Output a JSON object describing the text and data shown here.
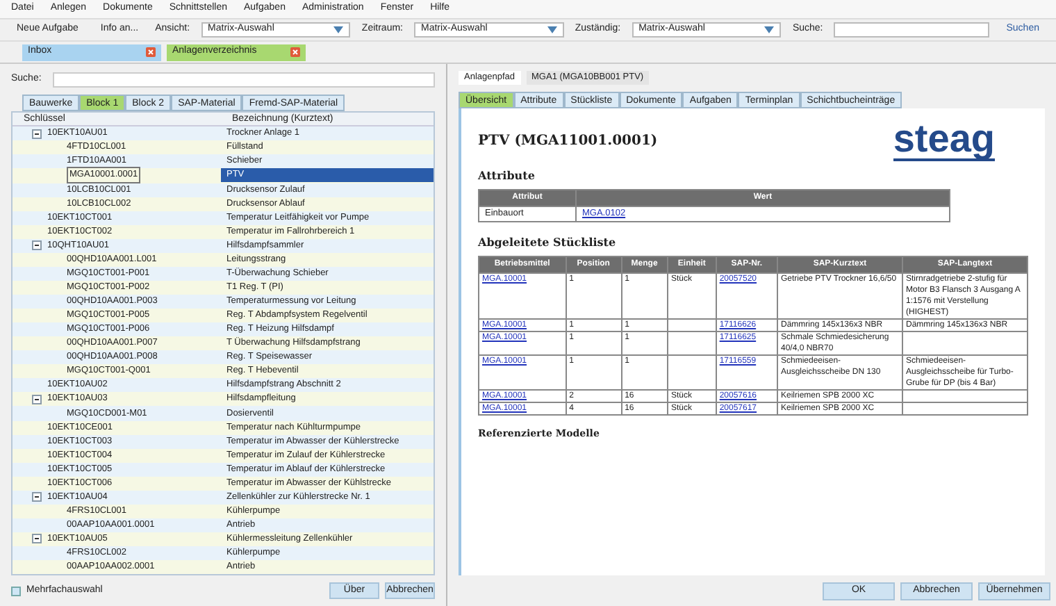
{
  "menu": [
    "Datei",
    "Anlegen",
    "Dokumente",
    "Schnittstellen",
    "Aufgaben",
    "Administration",
    "Fenster",
    "Hilfe"
  ],
  "toolbar": {
    "buttons": [
      "Neue Aufgabe",
      "Info an..."
    ],
    "filters": [
      {
        "label": "Ansicht:",
        "value": "Matrix-Auswahl"
      },
      {
        "label": "Zeitraum:",
        "value": "Matrix-Auswahl"
      },
      {
        "label": "Zuständig:",
        "value": "Matrix-Auswahl"
      }
    ],
    "search_label": "Suche:",
    "search_button": "Suchen"
  },
  "doc_tabs": [
    {
      "label": "Inbox",
      "color": "#a9d3f0"
    },
    {
      "label": "Anlagenverzeichnis",
      "color": "#a8d870"
    }
  ],
  "left": {
    "search_label": "Suche:",
    "tabs": [
      {
        "label": "Bauwerke",
        "selected": false
      },
      {
        "label": "Block 1",
        "selected": true
      },
      {
        "label": "Block 2",
        "selected": false
      },
      {
        "label": "SAP-Material",
        "selected": false
      },
      {
        "label": "Fremd-SAP-Material",
        "selected": false
      }
    ],
    "columns": [
      "Schlüssel",
      "Bezeichnung (Kurztext)"
    ],
    "tree": [
      {
        "key": "10EKT10AU01",
        "text": "Trockner Anlage 1",
        "expanded": true,
        "selected": false,
        "children": [
          {
            "key": "4FTD10CL001",
            "text": "Füllstand",
            "selected": false
          },
          {
            "key": "1FTD10AA001",
            "text": "Schieber",
            "selected": false
          },
          {
            "key": "MGA10001.0001",
            "text": "PTV",
            "selected": true
          },
          {
            "key": "10LCB10CL001",
            "text": "Drucksensor Zulauf",
            "selected": false
          },
          {
            "key": "10LCB10CL002",
            "text": "Drucksensor Ablauf",
            "selected": false
          }
        ]
      },
      {
        "key": "10EKT10CT001",
        "text": "Temperatur Leitfähigkeit vor Pumpe",
        "selected": false
      },
      {
        "key": "10EKT10CT002",
        "text": "Temperatur im Fallrohrbereich 1",
        "selected": false
      },
      {
        "key": "10QHT10AU01",
        "text": "Hilfsdampfsammler",
        "expanded": true,
        "selected": false,
        "children": [
          {
            "key": "00QHD10AA001.L001",
            "text": "Leitungsstrang",
            "selected": false
          },
          {
            "key": "MGQ10CT001-P001",
            "text": "T-Überwachung Schieber",
            "selected": false
          },
          {
            "key": "MGQ10CT001-P002",
            "text": "T1 Reg. T (PI)",
            "selected": false
          },
          {
            "key": "00QHD10AA001.P003",
            "text": "Temperaturmessung vor Leitung",
            "selected": false
          },
          {
            "key": "MGQ10CT001-P005",
            "text": "Reg. T Abdampfsystem Regelventil",
            "selected": false
          },
          {
            "key": "MGQ10CT001-P006",
            "text": "Reg. T Heizung Hilfsdampf",
            "selected": false
          },
          {
            "key": "00QHD10AA001.P007",
            "text": "T Überwachung Hilfsdampfstrang",
            "selected": false
          },
          {
            "key": "00QHD10AA001.P008",
            "text": "Reg. T Speisewasser",
            "selected": false
          },
          {
            "key": "MGQ10CT001-Q001",
            "text": "Reg. T Hebeventil",
            "selected": false
          }
        ]
      },
      {
        "key": "10EKT10AU02",
        "text": "Hilfsdampfstrang Abschnitt 2",
        "selected": false
      },
      {
        "key": "10EKT10AU03",
        "text": "Hilfsdampfleitung",
        "expanded": true,
        "selected": false,
        "children": [
          {
            "key": "MGQ10CD001-M01",
            "text": "Dosierventil",
            "selected": false
          }
        ]
      },
      {
        "key": "10EKT10CE001",
        "text": "Temperatur nach Kühlturmpumpe",
        "selected": false
      },
      {
        "key": "10EKT10CT003",
        "text": "Temperatur im Abwasser der Kühlerstrecke",
        "selected": false
      },
      {
        "key": "10EKT10CT004",
        "text": "Temperatur im Zulauf der Kühlerstrecke",
        "selected": false
      },
      {
        "key": "10EKT10CT005",
        "text": "Temperatur im Ablauf der Kühlerstrecke",
        "selected": false
      },
      {
        "key": "10EKT10CT006",
        "text": "Temperatur im Abwasser der Kühlstrecke",
        "selected": false
      },
      {
        "key": "10EKT10AU04",
        "text": "Zellenkühler zur Kühlerstrecke Nr. 1",
        "expanded": true,
        "selected": false,
        "children": [
          {
            "key": "4FRS10CL001",
            "text": "Kühlerpumpe",
            "selected": false
          },
          {
            "key": "00AAP10AA001.0001",
            "text": "Antrieb",
            "selected": false
          }
        ]
      },
      {
        "key": "10EKT10AU05",
        "text": "Kühlermessleitung Zellenkühler",
        "expanded": true,
        "selected": false,
        "children": [
          {
            "key": "4FRS10CL002",
            "text": "Kühlerpumpe",
            "selected": false
          },
          {
            "key": "00AAP10AA002.0001",
            "text": "Antrieb",
            "selected": false
          }
        ]
      }
    ],
    "multi_select": {
      "label": "Mehrfachauswahl",
      "checked": false
    },
    "buttons": [
      "Über",
      "Abbrechen"
    ]
  },
  "right": {
    "tabs": [
      {
        "label": "Anlagenpfad",
        "selected": true
      },
      {
        "label": "MGA1 (MGA10BB001 PTV)",
        "selected": false
      }
    ],
    "subtabs": [
      {
        "label": "Übersicht",
        "selected": true
      },
      {
        "label": "Attribute",
        "selected": false
      },
      {
        "label": "Stückliste",
        "selected": false
      },
      {
        "label": "Dokumente",
        "selected": false
      },
      {
        "label": "Aufgaben",
        "selected": false
      },
      {
        "label": "Terminplan",
        "selected": false
      },
      {
        "label": "Schichtbucheinträge",
        "selected": false
      }
    ],
    "title": "PTV (MGA11001.0001)",
    "logo": "steag",
    "attributes_heading": "Attribute",
    "attributes": {
      "columns": [
        "Attribut",
        "Wert"
      ],
      "rows": [
        [
          "Einbauort",
          "MGA.0102"
        ]
      ]
    },
    "bom_heading": "Abgeleitete Stückliste",
    "bom": {
      "columns": [
        "Betriebsmittel",
        "Position",
        "Menge",
        "Einheit",
        "SAP-Nr.",
        "SAP-Kurztext",
        "SAP-Langtext"
      ],
      "rows": [
        [
          "MGA.10001",
          "1",
          "1",
          "Stück",
          "20057520",
          "Getriebe PTV Trockner 16,6/50",
          "Stirnradgetriebe 2-stufig für Motor B3 Flansch 3 Ausgang A 1:1576 mit Verstellung (HIGHEST)"
        ],
        [
          "MGA.10001",
          "1",
          "1",
          "",
          "17116626",
          "Dämmring 145x136x3 NBR",
          "Dämmring 145x136x3 NBR"
        ],
        [
          "MGA.10001",
          "1",
          "1",
          "",
          "17116625",
          "Schmale Schmiedesicherung 40/4,0 NBR70",
          ""
        ],
        [
          "MGA.10001",
          "1",
          "1",
          "",
          "17116559",
          "Schmiedeeisen-Ausgleichsscheibe DN 130",
          "Schmiedeeisen-Ausgleichsscheibe für Turbo-Grube für DP (bis 4 Bar)"
        ],
        [
          "MGA.10001",
          "2",
          "16",
          "Stück",
          "20057616",
          "Keilriemen SPB 2000 XC",
          ""
        ],
        [
          "MGA.10001",
          "4",
          "16",
          "Stück",
          "20057617",
          "Keilriemen SPB 2000 XC",
          ""
        ]
      ]
    },
    "models_heading": "Referenzierte Modelle"
  },
  "footer_buttons": [
    "OK",
    "Abbrechen",
    "Übernehmen"
  ]
}
